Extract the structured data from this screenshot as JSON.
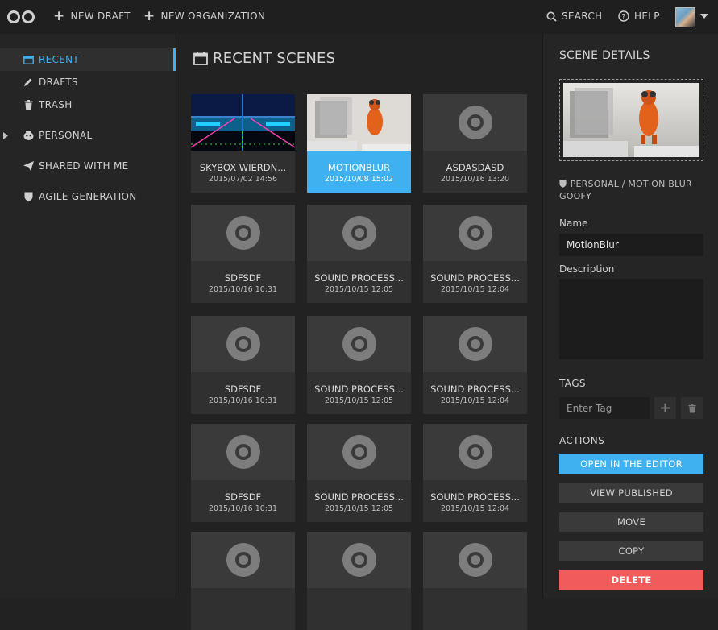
{
  "topbar": {
    "new_draft": "NEW DRAFT",
    "new_organization": "NEW ORGANIZATION",
    "search": "SEARCH",
    "help": "HELP"
  },
  "sidebar": {
    "items": [
      {
        "label": "RECENT",
        "icon": "calendar-icon"
      },
      {
        "label": "DRAFTS",
        "icon": "pencil-icon"
      },
      {
        "label": "TRASH",
        "icon": "trash-icon"
      },
      {
        "label": "PERSONAL",
        "icon": "user-face-icon"
      },
      {
        "label": "SHARED WITH ME",
        "icon": "paper-plane-icon"
      },
      {
        "label": "AGILE GENERATION",
        "icon": "shield-icon"
      }
    ]
  },
  "main": {
    "title": "RECENT SCENES",
    "scenes": [
      {
        "name": "SKYBOX WIERDN...",
        "date": "2015/07/02 14:56",
        "thumb": "skybox"
      },
      {
        "name": "MOTIONBLUR",
        "date": "2015/10/08 15:02",
        "thumb": "motionblur",
        "selected": true
      },
      {
        "name": "ASDASDASD",
        "date": "2015/10/16 13:20",
        "thumb": "placeholder"
      },
      {
        "name": "SDFSDF",
        "date": "2015/10/16 10:31",
        "thumb": "placeholder"
      },
      {
        "name": "SOUND PROCESS...",
        "date": "2015/10/15 12:05",
        "thumb": "placeholder"
      },
      {
        "name": "SOUND PROCESS...",
        "date": "2015/10/15 12:04",
        "thumb": "placeholder"
      },
      {
        "name": "SDFSDF",
        "date": "2015/10/16 10:31",
        "thumb": "placeholder"
      },
      {
        "name": "SOUND PROCESS...",
        "date": "2015/10/15 12:05",
        "thumb": "placeholder"
      },
      {
        "name": "SOUND PROCESS...",
        "date": "2015/10/15 12:04",
        "thumb": "placeholder"
      },
      {
        "name": "SDFSDF",
        "date": "2015/10/16 10:31",
        "thumb": "placeholder"
      },
      {
        "name": "SOUND PROCESS...",
        "date": "2015/10/15 12:05",
        "thumb": "placeholder"
      },
      {
        "name": "SOUND PROCESS...",
        "date": "2015/10/15 12:04",
        "thumb": "placeholder"
      },
      {
        "name": "",
        "date": "",
        "thumb": "placeholder"
      },
      {
        "name": "",
        "date": "",
        "thumb": "placeholder"
      },
      {
        "name": "",
        "date": "",
        "thumb": "placeholder"
      }
    ]
  },
  "details": {
    "title": "SCENE DETAILS",
    "path": "PERSONAL / MOTION BLUR GOOFY",
    "name_label": "Name",
    "name_value": "MotionBlur",
    "description_label": "Description",
    "description_value": "",
    "tags_label": "TAGS",
    "tag_placeholder": "Enter Tag",
    "actions_label": "ACTIONS",
    "actions": {
      "open": "OPEN IN THE EDITOR",
      "view": "VIEW PUBLISHED",
      "move": "MOVE",
      "copy": "COPY",
      "delete": "DELETE"
    }
  },
  "colors": {
    "accent": "#3fb0f0",
    "danger": "#f25b5b",
    "background": "#222222",
    "panel": "#252525"
  }
}
